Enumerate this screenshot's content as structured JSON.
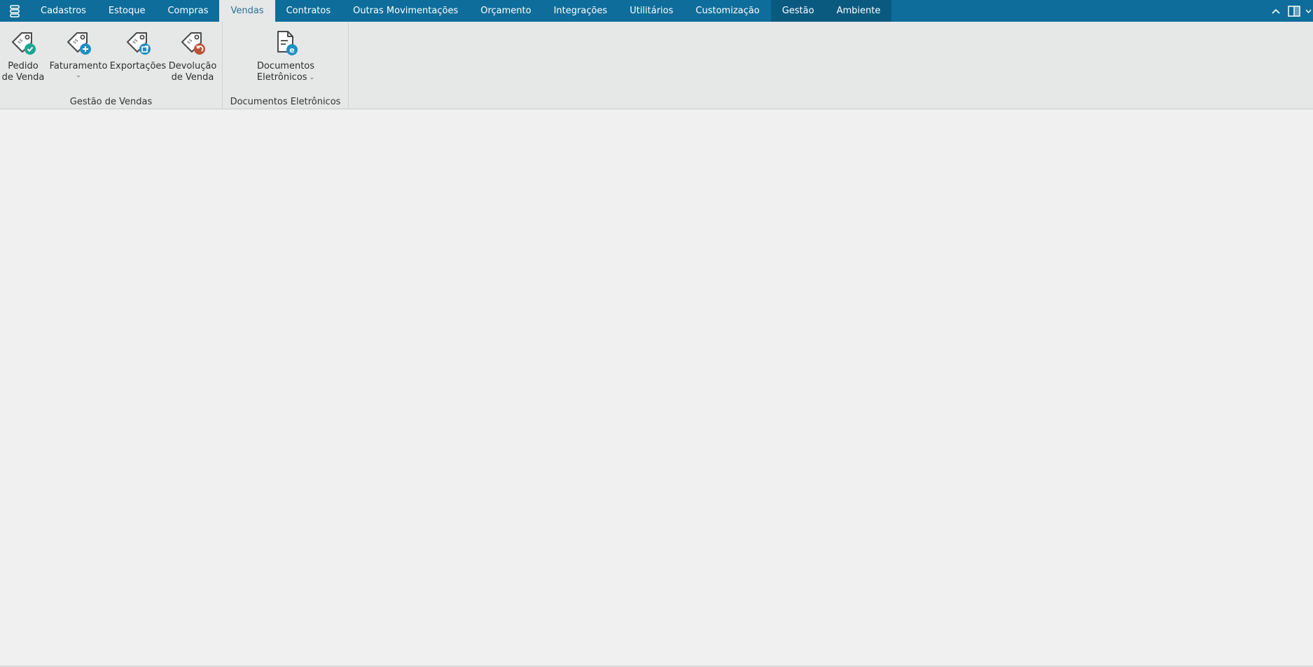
{
  "tabs": [
    {
      "label": "Cadastros"
    },
    {
      "label": "Estoque"
    },
    {
      "label": "Compras"
    },
    {
      "label": "Vendas",
      "active": true
    },
    {
      "label": "Contratos"
    },
    {
      "label": "Outras Movimentações"
    },
    {
      "label": "Orçamento"
    },
    {
      "label": "Integrações"
    },
    {
      "label": "Utilitários"
    },
    {
      "label": "Customização"
    },
    {
      "label": "Gestão"
    },
    {
      "label": "Ambiente"
    }
  ],
  "ribbon": {
    "groups": [
      {
        "label": "Gestão de Vendas",
        "buttons": [
          {
            "line1": "Pedido",
            "line2": "de Venda",
            "icon": "tag-check-icon",
            "badge_color": "#1aa68f"
          },
          {
            "line1": "Faturamento",
            "line2": "",
            "icon": "tag-plus-icon",
            "badge_color": "#1f8fc4",
            "dropdown": true
          },
          {
            "line1": "Exportações",
            "line2": "",
            "icon": "tag-export-icon",
            "badge_color": "#1f8fc4"
          },
          {
            "line1": "Devolução",
            "line2": "de Venda",
            "icon": "tag-return-icon",
            "badge_color": "#c0523a"
          }
        ]
      },
      {
        "label": "Documentos Eletrônicos",
        "buttons": [
          {
            "line1": "Documentos",
            "line2": "Eletrônicos",
            "icon": "electronic-document-icon",
            "badge_color": "#1f8fc4",
            "dropdown": true
          }
        ]
      }
    ]
  },
  "colors": {
    "tabbar": "#0e6d9a",
    "ribbon": "#e6e8e8",
    "workspace": "#f0f0f0"
  }
}
